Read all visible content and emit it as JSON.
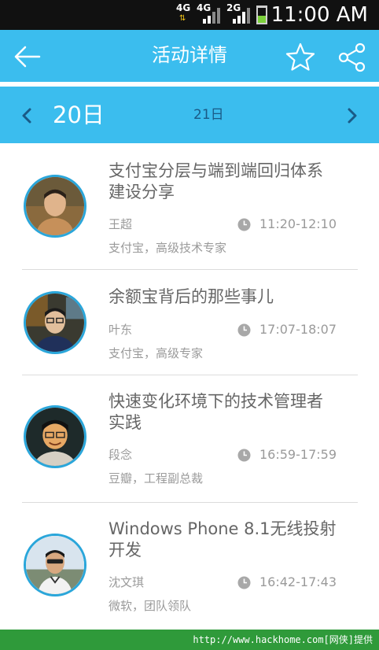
{
  "status_bar": {
    "network_1": "4G",
    "network_2": "4G",
    "network_3": "2G",
    "time": "11:00 AM",
    "battery_level": 0.45
  },
  "header": {
    "title": "活动详情",
    "back_icon": "arrow-left-icon",
    "favorite_icon": "star-icon",
    "share_icon": "share-icon"
  },
  "days": {
    "current": "20日",
    "next": "21日",
    "prev_icon": "chevron-left-icon",
    "next_icon": "chevron-right-icon"
  },
  "sessions": [
    {
      "title_line1": "支付宝分层与端到端回归体系",
      "title_line2": "建设分享",
      "speaker": "王超",
      "time": "11:20-12:10",
      "role": "支付宝，高级技术专家"
    },
    {
      "title_line1": "余额宝背后的那些事儿",
      "title_line2": "",
      "speaker": "叶东",
      "time": "17:07-18:07",
      "role": "支付宝，高级专家"
    },
    {
      "title_line1": "快速变化环境下的技术管理者",
      "title_line2": "实践",
      "speaker": "段念",
      "time": "16:59-17:59",
      "role": "豆瓣，工程副总裁"
    },
    {
      "title_line1": "Windows Phone 8.1无线投射",
      "title_line2": "开发",
      "speaker": "沈文琪",
      "time": "16:42-17:43",
      "role": "微软，团队领队"
    }
  ],
  "footer": {
    "credit": "http://www.hackhome.com[网侠]提供"
  },
  "colors": {
    "accent": "#3bbdee",
    "footer_green": "#2f9a3a",
    "avatar_ring": "#2aa6da"
  }
}
